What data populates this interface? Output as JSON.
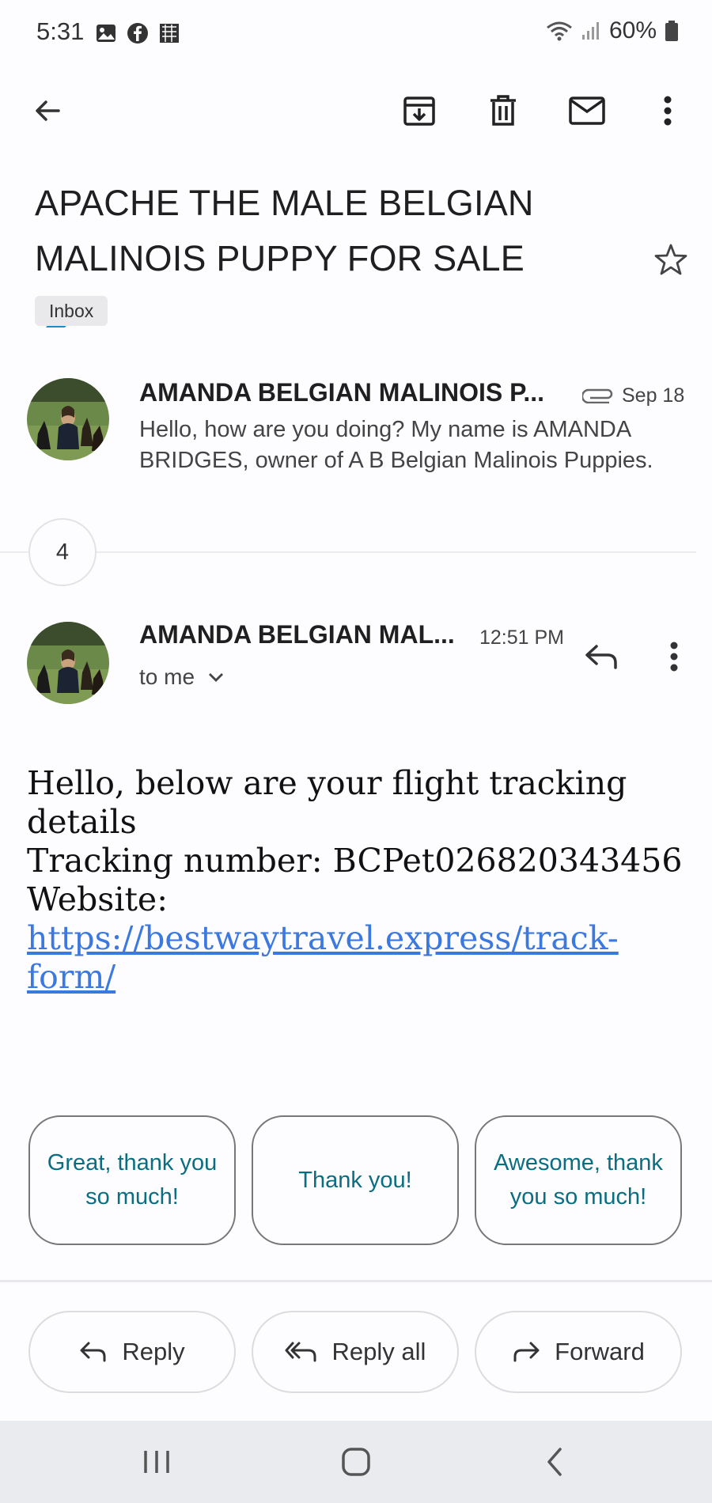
{
  "status_bar": {
    "time": "5:31",
    "battery": "60%"
  },
  "toolbar": {
    "icons": [
      "back-arrow-icon",
      "archive-icon",
      "delete-icon",
      "mark-unread-icon",
      "more-vert-icon"
    ]
  },
  "subject": {
    "text": "APACHE THE MALE BELGIAN MALINOIS PUPPY FOR SALE",
    "label_color": "#1a8ec9",
    "chip": "Inbox"
  },
  "first_message": {
    "sender": "AMANDA BELGIAN MALINOIS P...",
    "date": "Sep 18",
    "preview": "Hello, how are you doing? My name is AMANDA BRIDGES, owner of A B Belgian Malinois Puppies."
  },
  "collapsed": {
    "count": "4"
  },
  "current_message": {
    "sender": "AMANDA BELGIAN MAL...",
    "time": "12:51 PM",
    "recipient": "to me",
    "body_line1": "Hello, below are your flight tracking details",
    "body_line2": "Tracking number: BCPet026820343456",
    "body_line3_prefix": "Website: ",
    "body_link": "https://bestwaytravel.express/track-form/"
  },
  "smart_replies": [
    "Great, thank you so much!",
    "Thank you!",
    "Awesome, thank you so much!"
  ],
  "actions": {
    "reply": "Reply",
    "reply_all": "Reply all",
    "forward": "Forward"
  },
  "colors": {
    "accent_teal": "#0b6e80",
    "link": "#3b78e0"
  }
}
